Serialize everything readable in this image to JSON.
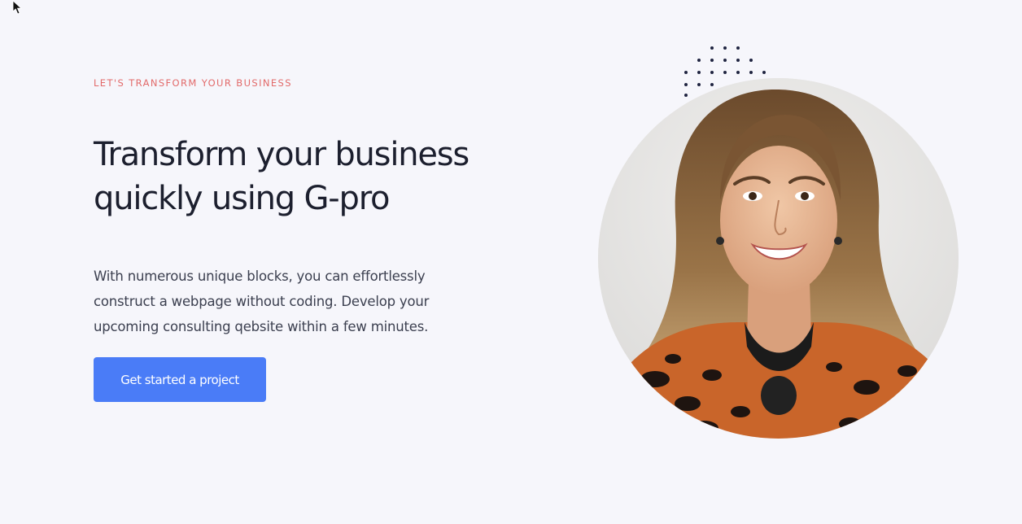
{
  "hero": {
    "eyebrow": "LET'S TRANSFORM YOUR BUSINESS",
    "headline_line1": "Transform your business",
    "headline_line2": "quickly using G-pro",
    "description_line1": "With numerous unique blocks, you can effortlessly",
    "description_line2": "construct a webpage without coding. Develop your",
    "description_line3": "upcoming consulting qebsite within a few minutes.",
    "cta_label": "Get started a project"
  },
  "colors": {
    "background": "#f6f6fb",
    "eyebrow": "#e26a6a",
    "headline": "#1c1f2e",
    "body_text": "#3b3f4f",
    "cta_background": "#4a7cf7",
    "dots": "#1f2440"
  },
  "icons": {
    "cursor": "mouse-cursor-icon",
    "decoration": "dot-pattern",
    "image": "woman-portrait-photo"
  }
}
